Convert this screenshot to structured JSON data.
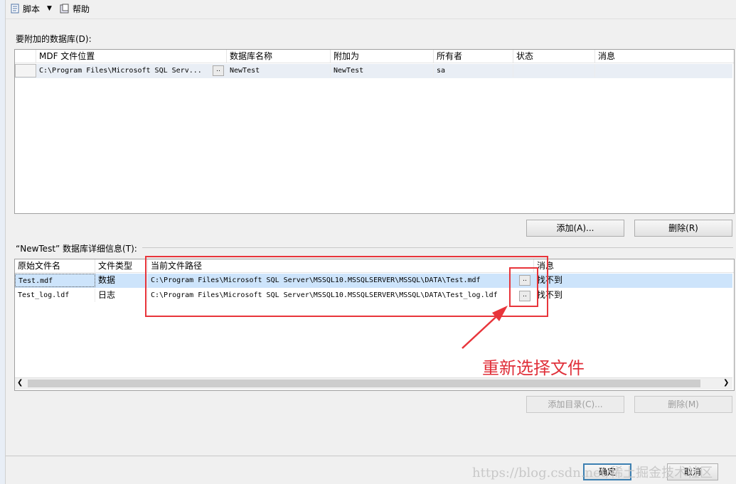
{
  "toolbar": {
    "script_label": "脚本",
    "help_label": "帮助"
  },
  "attach_section": {
    "label": "要附加的数据库(D):",
    "columns": [
      "MDF 文件位置",
      "数据库名称",
      "附加为",
      "所有者",
      "状态",
      "消息"
    ],
    "rows": [
      {
        "mdf": "C:\\Program Files\\Microsoft SQL Serv...",
        "browse": "..",
        "db_name": "NewTest",
        "attach_as": "NewTest",
        "owner": "sa",
        "status": "",
        "message": ""
      }
    ],
    "add_button": "添加(A)...",
    "remove_button": "删除(R)"
  },
  "detail_section": {
    "label": "“NewTest” 数据库详细信息(T):",
    "columns": [
      "原始文件名",
      "文件类型",
      "当前文件路径",
      "消息"
    ],
    "rows": [
      {
        "file": "Test.mdf",
        "type": "数据",
        "path": "C:\\Program Files\\Microsoft SQL Server\\MSSQL10.MSSQLSERVER\\MSSQL\\DATA\\Test.mdf",
        "browse": "..",
        "message": "找不到"
      },
      {
        "file": "Test_log.ldf",
        "type": "日志",
        "path": "C:\\Program Files\\Microsoft SQL Server\\MSSQL10.MSSQLSERVER\\MSSQL\\DATA\\Test_log.ldf",
        "browse": "..",
        "message": "找不到"
      }
    ],
    "add_catalog_button": "添加目录(C)...",
    "remove_button": "删除(M)"
  },
  "annotation": {
    "text": "重新选择文件",
    "color": "#e8353b"
  },
  "footer": {
    "ok_button": "确定",
    "cancel_button": "取消"
  },
  "watermark": "https://blog.csdn.net/稀土掘金技术社区",
  "colors": {
    "selection": "#cde4fb",
    "accent": "#3c7fb1"
  }
}
